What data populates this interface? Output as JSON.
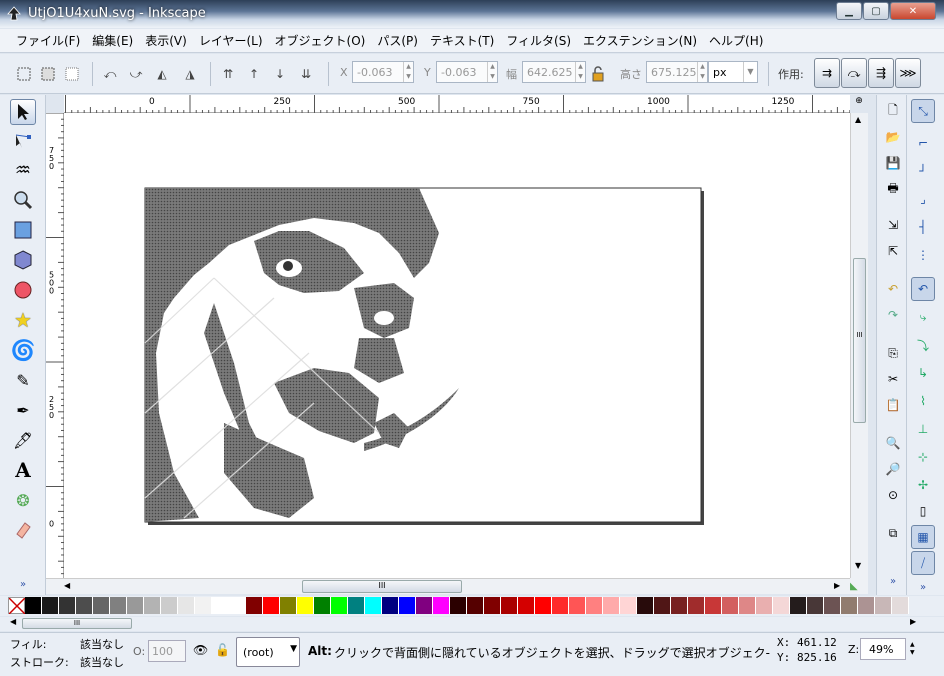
{
  "window": {
    "title": "UtjO1U4xuN.svg - Inkscape"
  },
  "menu": [
    "ファイル(F)",
    "編集(E)",
    "表示(V)",
    "レイヤー(L)",
    "オブジェクト(O)",
    "パス(P)",
    "テキスト(T)",
    "フィルタ(S)",
    "エクステンション(N)",
    "ヘルプ(H)"
  ],
  "toolbar": {
    "x_label": "X",
    "x_value": "-0.063",
    "y_label": "Y",
    "y_value": "-0.063",
    "w_label": "幅",
    "w_value": "642.625",
    "h_label": "高さ",
    "h_value": "675.125",
    "unit": "px",
    "affect_label": "作用:"
  },
  "ruler": {
    "top": [
      "0",
      "250",
      "500",
      "750",
      "1000",
      "1250"
    ],
    "left": [
      "750",
      "500",
      "250",
      "0"
    ]
  },
  "palette": [
    "#000000",
    "#1a1a1a",
    "#333333",
    "#4d4d4d",
    "#666666",
    "#808080",
    "#999999",
    "#b3b3b3",
    "#cccccc",
    "#e6e6e6",
    "#f2f2f2",
    "#ffffff",
    "#ffffff",
    "#800000",
    "#ff0000",
    "#808000",
    "#ffff00",
    "#008000",
    "#00ff00",
    "#008080",
    "#00ffff",
    "#000080",
    "#0000ff",
    "#800080",
    "#ff00ff",
    "#2b0000",
    "#550000",
    "#800000",
    "#aa0000",
    "#d40000",
    "#ff0000",
    "#ff2a2a",
    "#ff5555",
    "#ff8080",
    "#ffaaaa",
    "#ffd5d5",
    "#280b0b",
    "#501616",
    "#782121",
    "#a02c2c",
    "#c83737",
    "#d35f5f",
    "#de8787",
    "#e9afaf",
    "#f4d7d7",
    "#241c1c",
    "#483737",
    "#6c5353",
    "#917c6f",
    "#ac9393",
    "#c8b7b7",
    "#e3dbdb"
  ],
  "status": {
    "fill_label": "フィル:",
    "fill_value": "該当なし",
    "stroke_label": "ストローク:",
    "stroke_value": "該当なし",
    "opacity_label": "O:",
    "opacity_value": "100",
    "layer": "(root)",
    "message_key": "Alt:",
    "message": "クリックで背面側に隠れているオブジェクトを選択、ドラッグで選択オブジェク-",
    "x_label": "X:",
    "x_value": "461.12",
    "y_label": "Y:",
    "y_value": "825.16",
    "zoom_label": "Z:",
    "zoom_value": "49%"
  },
  "scroll_marks": {
    "h": "III",
    "v": "III"
  }
}
